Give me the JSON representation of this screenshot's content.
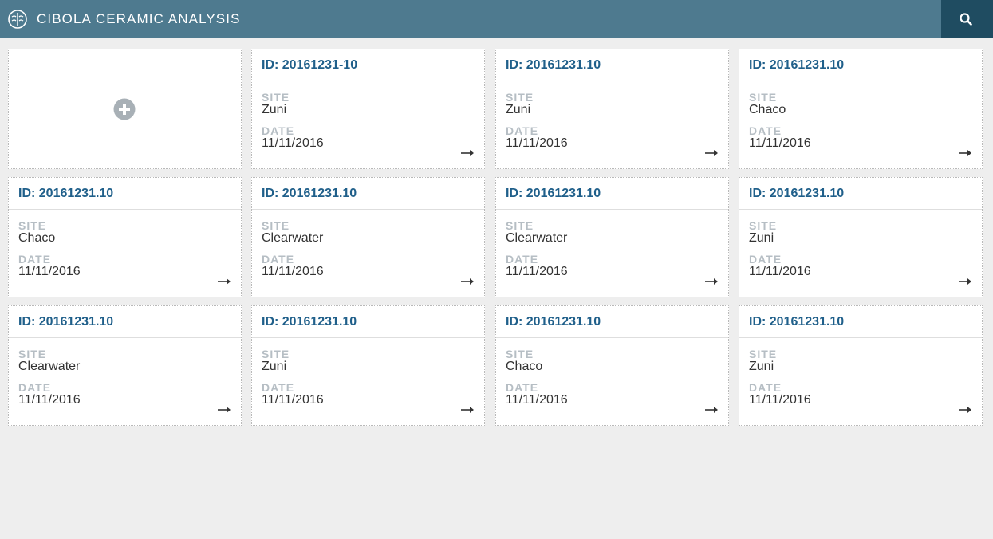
{
  "header": {
    "title": "CIBOLA CERAMIC ANALYSIS",
    "logo_icon": "brain-icon",
    "search_icon": "search-icon"
  },
  "colors": {
    "header_bg": "#4e7a8f",
    "search_bg": "#1f4c61",
    "id_text": "#1f5f8a",
    "label_text": "#b6bec4",
    "page_bg": "#eeeeee"
  },
  "add_card": {
    "icon": "plus-circle-icon"
  },
  "labels": {
    "site": "SITE",
    "date": "DATE"
  },
  "cards": [
    {
      "id": "ID: 20161231-10",
      "site": "Zuni",
      "date": "11/11/2016"
    },
    {
      "id": "ID: 20161231.10",
      "site": "Zuni",
      "date": "11/11/2016"
    },
    {
      "id": "ID: 20161231.10",
      "site": "Chaco",
      "date": "11/11/2016"
    },
    {
      "id": "ID: 20161231.10",
      "site": "Chaco",
      "date": "11/11/2016"
    },
    {
      "id": "ID: 20161231.10",
      "site": "Clearwater",
      "date": "11/11/2016"
    },
    {
      "id": "ID: 20161231.10",
      "site": "Clearwater",
      "date": "11/11/2016"
    },
    {
      "id": "ID: 20161231.10",
      "site": "Zuni",
      "date": "11/11/2016"
    },
    {
      "id": "ID: 20161231.10",
      "site": "Clearwater",
      "date": "11/11/2016"
    },
    {
      "id": "ID: 20161231.10",
      "site": "Zuni",
      "date": "11/11/2016"
    },
    {
      "id": "ID: 20161231.10",
      "site": "Chaco",
      "date": "11/11/2016"
    },
    {
      "id": "ID: 20161231.10",
      "site": "Zuni",
      "date": "11/11/2016"
    }
  ]
}
